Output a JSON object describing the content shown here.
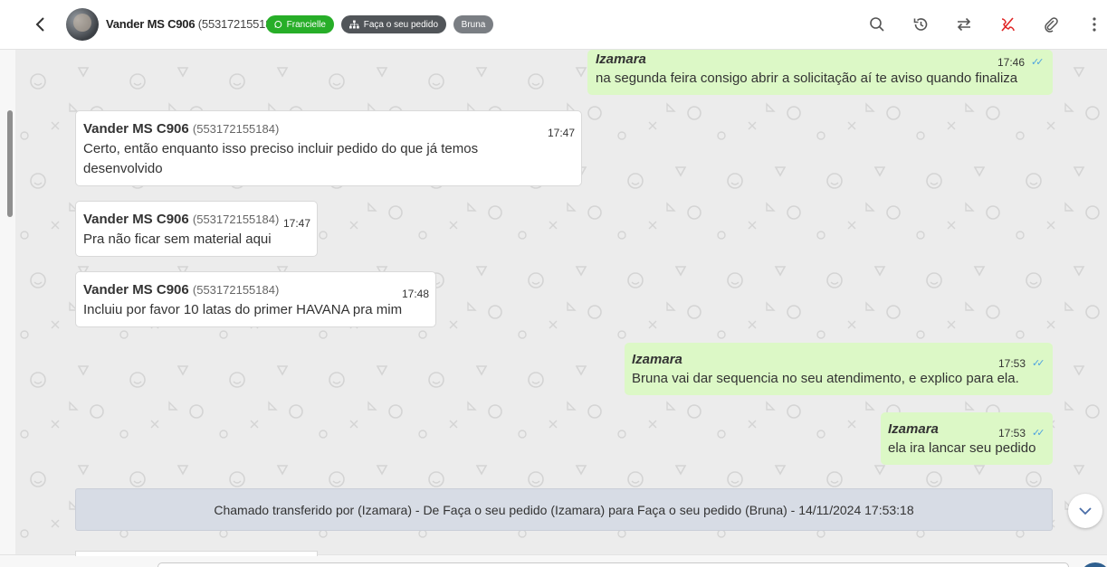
{
  "header": {
    "contact_name": "Vander MS C906",
    "contact_phone": "(553172155184)",
    "badges": [
      {
        "label": "Francielle",
        "color": "#27ae28",
        "icon": "whatsapp-icon"
      },
      {
        "label": "Faça o seu pedido",
        "color": "#515559",
        "icon": "sitemap-icon"
      },
      {
        "label": "Bruna",
        "color": "#7a7e83"
      }
    ],
    "icons": [
      "search-icon",
      "history-icon",
      "transfer-icon",
      "end-chat-icon",
      "attachment-icon",
      "more-icon"
    ]
  },
  "messages": [
    {
      "direction": "out",
      "sender": "Izamara",
      "time": "17:46",
      "text": "na segunda feira consigo abrir a solicitação aí te aviso quando finaliza"
    },
    {
      "direction": "in",
      "sender": "Vander MS C906",
      "phone": "(553172155184)",
      "time": "17:47",
      "text": "Certo, então enquanto isso preciso incluir pedido do que já temos desenvolvido"
    },
    {
      "direction": "in",
      "sender": "Vander MS C906",
      "phone": "(553172155184)",
      "time": "17:47",
      "text": "Pra não ficar sem material aqui"
    },
    {
      "direction": "in",
      "sender": "Vander MS C906",
      "phone": "(553172155184)",
      "time": "17:48",
      "text": "Incluiu por favor 10 latas do primer HAVANA pra mim"
    },
    {
      "direction": "out",
      "sender": "Izamara",
      "time": "17:53",
      "text": "Bruna vai dar sequencia no seu atendimento, e explico para ela."
    },
    {
      "direction": "out",
      "sender": "Izamara",
      "time": "17:53",
      "text": "ela ira lancar seu pedido"
    }
  ],
  "system_message": "Chamado transferido por (Izamara) - De Faça o seu pedido (Izamara) para Faça o seu pedido (Bruna) - 14/11/2024 17:53:18"
}
